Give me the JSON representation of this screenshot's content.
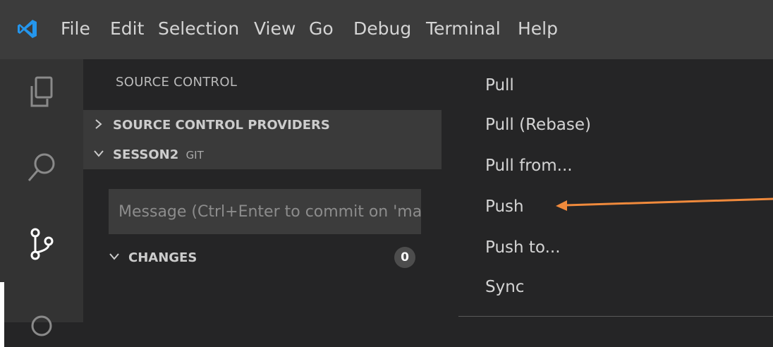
{
  "menu": {
    "items": [
      "File",
      "Edit",
      "Selection",
      "View",
      "Go",
      "Debug",
      "Terminal",
      "Help"
    ]
  },
  "activity_bar": {
    "icons": [
      "explorer-icon",
      "search-icon",
      "source-control-icon",
      "debug-icon"
    ],
    "active": "source-control-icon"
  },
  "sidebar": {
    "title": "SOURCE CONTROL",
    "providers_label": "SOURCE CONTROL PROVIDERS",
    "repo_name": "SESSON2",
    "repo_type": "GIT",
    "commit_placeholder": "Message (Ctrl+Enter to commit on 'master')",
    "changes_label": "CHANGES",
    "changes_count": "0"
  },
  "dropdown": {
    "items": [
      "Pull",
      "Pull (Rebase)",
      "Pull from...",
      "Push",
      "Push to...",
      "Sync"
    ]
  },
  "colors": {
    "title_bar": "#3c3c3c",
    "activity_bar": "#333333",
    "sidebar": "#252526",
    "section_header": "#3a3a3a",
    "input": "#3c3c3c",
    "annotation_arrow": "#f08a3c",
    "vscode_blue": "#2496ed"
  }
}
